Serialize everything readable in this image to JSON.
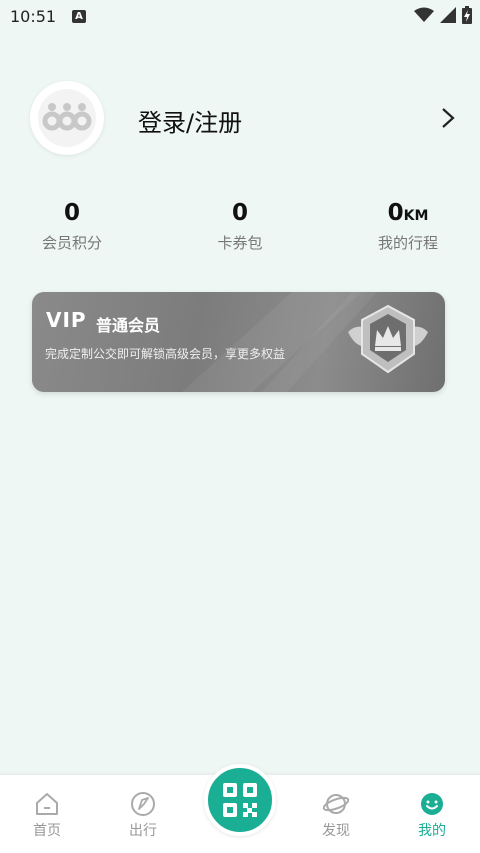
{
  "status_bar": {
    "time": "10:51",
    "notification_icon_letter": "A",
    "icons": [
      "wifi-icon",
      "signal-icon",
      "battery-charging-icon"
    ]
  },
  "profile": {
    "avatar_icon": "default-avatar-logo",
    "login_label": "登录/注册",
    "chevron_icon": "chevron-right-icon"
  },
  "stats": [
    {
      "value": "0",
      "unit": "",
      "label": "会员积分"
    },
    {
      "value": "0",
      "unit": "",
      "label": "卡券包"
    },
    {
      "value": "0",
      "unit": "KM",
      "label": "我的行程"
    }
  ],
  "vip_card": {
    "title": "VIP",
    "level": "普通会员",
    "description": "完成定制公交即可解锁高级会员，享更多权益",
    "badge_icon": "crown-shield-badge"
  },
  "bottom_nav": {
    "items": [
      {
        "label": "首页",
        "icon": "home-icon",
        "active": false
      },
      {
        "label": "出行",
        "icon": "compass-icon",
        "active": false
      },
      {
        "label": "发现",
        "icon": "planet-icon",
        "active": false
      },
      {
        "label": "我的",
        "icon": "smiley-icon",
        "active": true
      }
    ],
    "center_button_icon": "qr-code-icon"
  },
  "colors": {
    "accent": "#1aae95",
    "background": "#eef7f3",
    "inactive": "#999999"
  }
}
